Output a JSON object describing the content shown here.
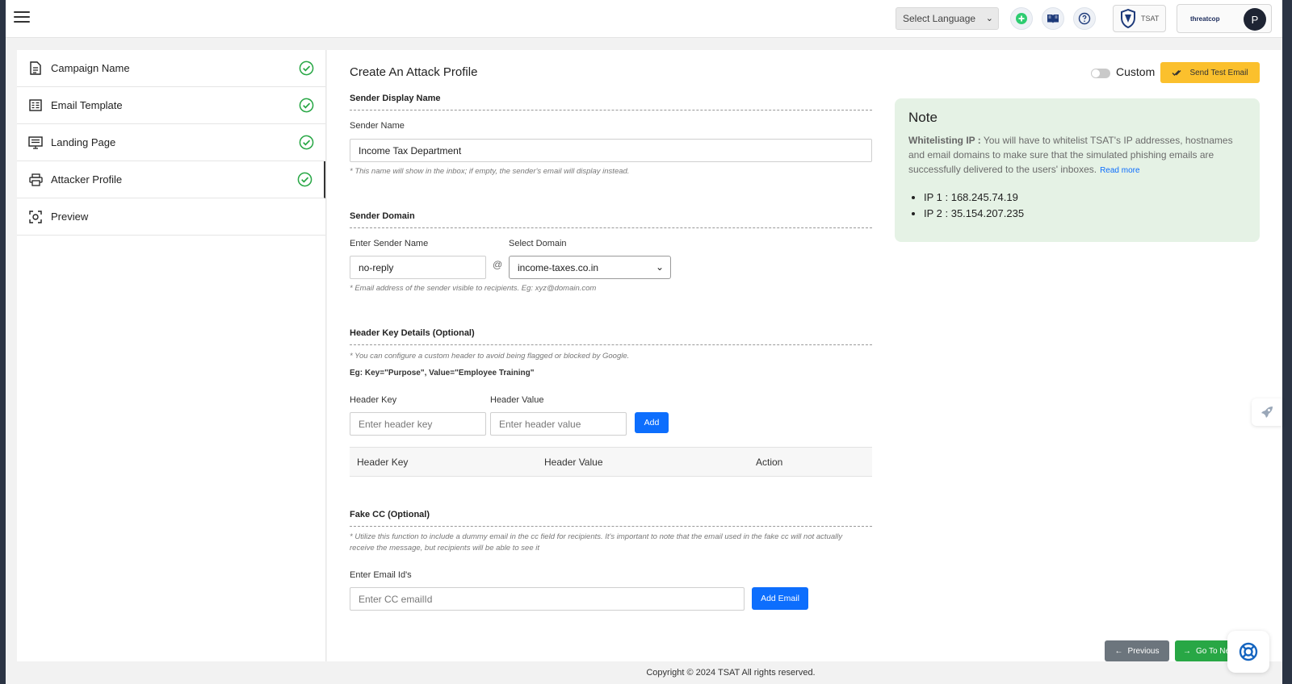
{
  "topbar": {
    "language_label": "Select Language",
    "tsat_label": "TSAT",
    "brand_label": "threatcop",
    "avatar_initial": "P"
  },
  "sidebar": {
    "items": [
      {
        "label": "Campaign Name",
        "completed": true
      },
      {
        "label": "Email Template",
        "completed": true
      },
      {
        "label": "Landing Page",
        "completed": true
      },
      {
        "label": "Attacker Profile",
        "completed": true,
        "active": true
      },
      {
        "label": "Preview",
        "completed": false
      }
    ]
  },
  "main": {
    "title": "Create An Attack Profile",
    "custom_label": "Custom",
    "send_test_label": "Send Test Email",
    "sender_display": {
      "heading": "Sender Display Name",
      "label": "Sender Name",
      "value": "Income Tax Department",
      "hint": "* This name will show in the inbox; if empty, the sender's email will display instead."
    },
    "sender_domain": {
      "heading": "Sender Domain",
      "name_label": "Enter Sender Name",
      "name_value": "no-reply",
      "at": "@",
      "domain_label": "Select Domain",
      "domain_value": "income-taxes.co.in",
      "hint": "* Email address of the sender visible to recipients. Eg: xyz@domain.com"
    },
    "header_key": {
      "heading": "Header Key Details (Optional)",
      "hint": "* You can configure a custom header to avoid being flagged or blocked by Google.",
      "example": "Eg: Key=\"Purpose\", Value=\"Employee Training\"",
      "key_label": "Header Key",
      "key_placeholder": "Enter header key",
      "value_label": "Header Value",
      "value_placeholder": "Enter header value",
      "add_label": "Add",
      "table_columns": [
        "Header Key",
        "Header Value",
        "Action"
      ]
    },
    "fake_cc": {
      "heading": "Fake CC (Optional)",
      "hint": "* Utilize this function to include a dummy email in the cc field for recipients. It's important to note that the email used in the fake cc will not actually receive the message, but recipients will be able to see it",
      "label": "Enter Email Id's",
      "placeholder": "Enter CC emailId",
      "add_label": "Add Email"
    }
  },
  "note": {
    "title": "Note",
    "bold_prefix": "Whitelisting IP :",
    "text": " You will have to whitelist TSAT's IP addresses, hostnames and email domains to make sure that the simulated phishing emails are successfully delivered to the users' inboxes.",
    "link": "Read more",
    "ips": [
      "IP 1 : 168.245.74.19",
      "IP 2 : 35.154.207.235"
    ]
  },
  "nav": {
    "previous_label": "Previous",
    "next_label": "Go To Next"
  },
  "footer": {
    "copyright": "Copyright © 2024 TSAT All rights reserved."
  },
  "colors": {
    "accent_blue": "#0d6efd",
    "send_yellow": "#fbc02d",
    "note_green_bg": "#e5f2e5",
    "check_green": "#28a745",
    "next_green": "#28a745",
    "prev_gray": "#6c757d"
  }
}
